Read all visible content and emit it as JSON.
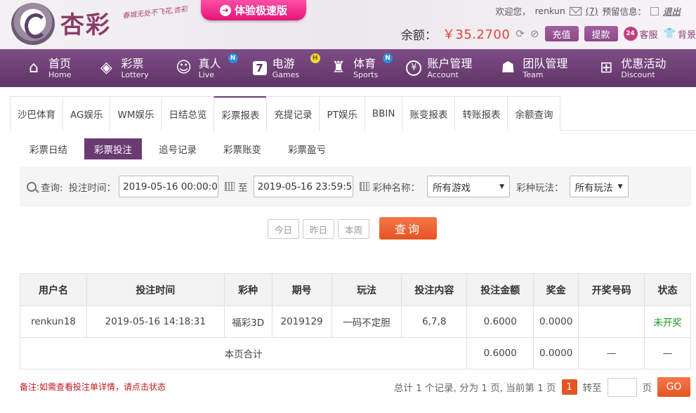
{
  "header": {
    "logo_text": "杏彩",
    "slogan": "春城无处不飞花,杏彩",
    "speed_button": "体验极速版",
    "welcome_prefix": "欢迎您，",
    "username": "renkun",
    "message_count": "(7)",
    "alert_label": "预留信息：",
    "logout": "退出",
    "balance_label": "余额：",
    "balance_value": "￥35.2700",
    "recharge": "充值",
    "withdraw": "提款",
    "service": "客服",
    "service_badge": "24",
    "background": "背景"
  },
  "nav": {
    "items": [
      {
        "cn": "首页",
        "en": "Home",
        "icon": "home-icon",
        "badge": ""
      },
      {
        "cn": "彩票",
        "en": "Lottery",
        "icon": "lottery-ticket-icon",
        "badge": ""
      },
      {
        "cn": "真人",
        "en": "Live",
        "icon": "live-dealer-icon",
        "badge": "N"
      },
      {
        "cn": "电游",
        "en": "Games",
        "icon": "seven-slot-icon",
        "badge": "H"
      },
      {
        "cn": "体育",
        "en": "Sports",
        "icon": "trophy-icon",
        "badge": "N"
      },
      {
        "cn": "账户管理",
        "en": "Account",
        "icon": "yen-coin-icon",
        "badge": ""
      },
      {
        "cn": "团队管理",
        "en": "Team",
        "icon": "team-icon",
        "badge": ""
      },
      {
        "cn": "优惠活动",
        "en": "Discount",
        "icon": "gift-icon",
        "badge": ""
      }
    ]
  },
  "tabs": [
    "沙巴体育",
    "AG娱乐",
    "WM娱乐",
    "日结总览",
    "彩票报表",
    "充提记录",
    "PT娱乐",
    "BBIN",
    "账变报表",
    "转账报表",
    "余额查询"
  ],
  "active_tab": "彩票报表",
  "subtabs": [
    "彩票日结",
    "彩票投注",
    "追号记录",
    "彩票账变",
    "彩票盈亏"
  ],
  "active_subtab": "彩票投注",
  "filter": {
    "query_label": "查询:",
    "time_label": "投注时间：",
    "start_time": "2019-05-16 00:00:00",
    "to_label": "至",
    "end_time": "2019-05-16 23:59:59",
    "lottery_label": "彩种名称：",
    "lottery_value": "所有游戏",
    "play_label": "彩种玩法：",
    "play_value": "所有玩法"
  },
  "quick": {
    "today": "今日",
    "yesterday": "昨日",
    "week": "本周",
    "search": "查询"
  },
  "table": {
    "headers": [
      "用户名",
      "投注时间",
      "彩种",
      "期号",
      "玩法",
      "投注内容",
      "投注金额",
      "奖金",
      "开奖号码",
      "状态"
    ],
    "rows": [
      [
        "renkun18",
        "2019-05-16 14:18:31",
        "福彩3D",
        "2019129",
        "一码不定胆",
        "6,7,8",
        "0.6000",
        "0.0000",
        "",
        "未开奖"
      ]
    ],
    "subtotal": {
      "label": "本页合计",
      "amount": "0.6000",
      "bonus": "0.0000",
      "draw": "—",
      "status": "—"
    }
  },
  "note": "备注:如需查看投注单详情，请点击状态",
  "pager": {
    "summary": "总计 1 个记录, 分为 1 页, 当前第 1 页",
    "current": "1",
    "goto": "转至",
    "page_unit": "页",
    "go": "GO"
  },
  "colors": {
    "nav_top": "#7e4d86",
    "nav_bottom": "#5f3466",
    "accent": "#e55423",
    "price": "#e8413a",
    "status_pending": "#1e9a1e"
  }
}
